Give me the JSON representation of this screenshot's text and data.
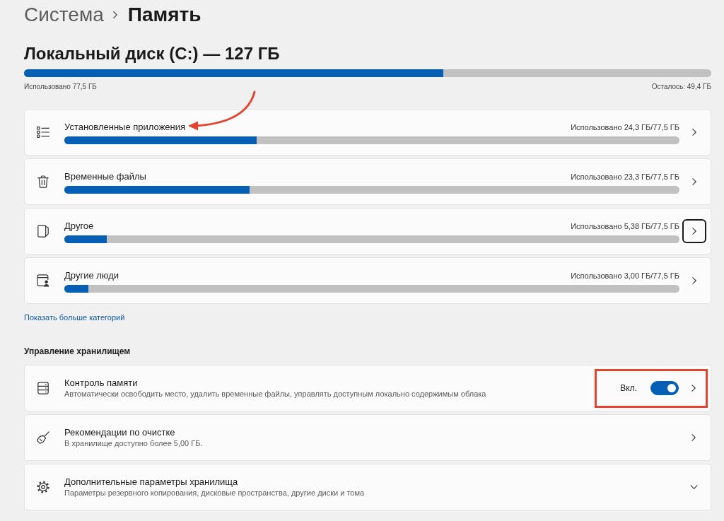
{
  "breadcrumb": [
    {
      "label": "Система",
      "current": false
    },
    {
      "label": "Память",
      "current": true
    }
  ],
  "disk": {
    "title": "Локальный диск (C:) — 127 ГБ",
    "level": 0.61,
    "used": "Использовано 77,5 ГБ",
    "free": "Осталось: 49,4 ГБ"
  },
  "categories": [
    {
      "label": "Установленные приложения",
      "usage": "Использовано 24,3 ГБ/77,5 ГБ",
      "level": 0.313,
      "focused": false,
      "annotated": true
    },
    {
      "label": "Временные файлы",
      "usage": "Использовано 23,3 ГБ/77,5 ГБ",
      "level": 0.301,
      "focused": false,
      "annotated": false
    },
    {
      "label": "Другое",
      "usage": "Использовано 5,38 ГБ/77,5 ГБ",
      "level": 0.069,
      "focused": true,
      "annotated": false
    },
    {
      "label": "Другие люди",
      "usage": "Использовано 3,00 ГБ/77,5 ГБ",
      "level": 0.039,
      "focused": false,
      "annotated": false
    }
  ],
  "more_link": "Показать больше категорий",
  "management": {
    "heading": "Управление хранилищем",
    "items": [
      {
        "kind": "toggle",
        "title": "Контроль памяти",
        "description": "Автоматически освободить место, удалить временные файлы, управлять доступным локально содержимым облака",
        "toggle_label": "Вкл.",
        "on": true,
        "annotated": true
      },
      {
        "kind": "link",
        "title": "Рекомендации по очистке",
        "description": "В хранилище доступно более 5,00 ГБ.",
        "annotated": false
      },
      {
        "kind": "expander",
        "title": "Дополнительные параметры хранилища",
        "description": "Параметры резервного копирования, дисковые пространства, другие диски и тома",
        "expanded": false,
        "annotated": false
      }
    ]
  }
}
